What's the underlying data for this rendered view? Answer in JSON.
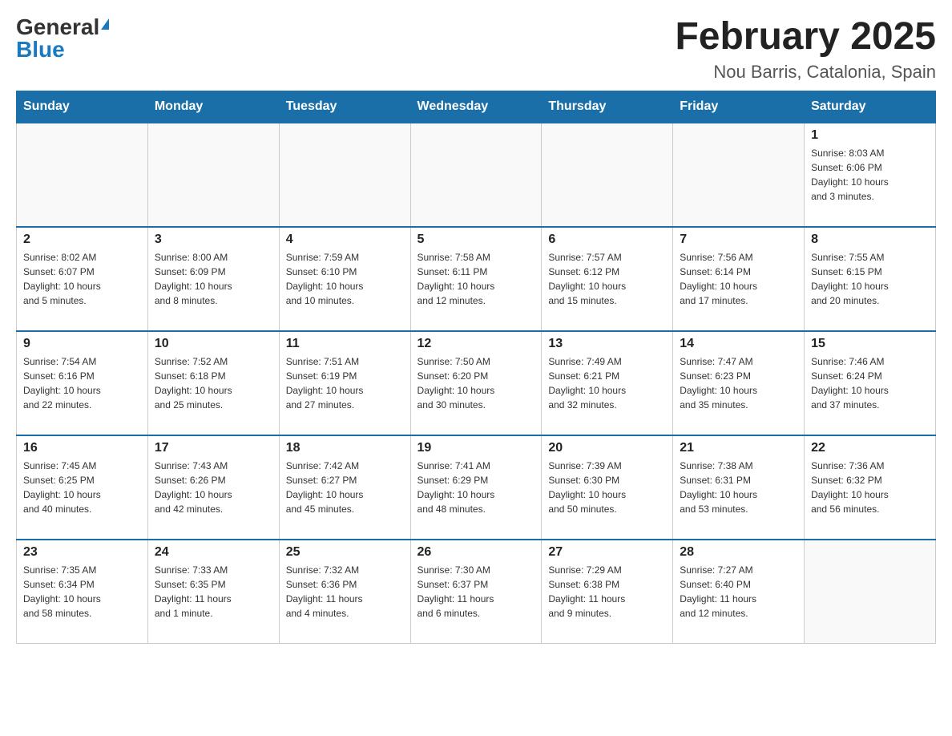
{
  "logo": {
    "general": "General",
    "blue": "Blue"
  },
  "title": "February 2025",
  "location": "Nou Barris, Catalonia, Spain",
  "weekdays": [
    "Sunday",
    "Monday",
    "Tuesday",
    "Wednesday",
    "Thursday",
    "Friday",
    "Saturday"
  ],
  "weeks": [
    [
      {
        "day": "",
        "info": ""
      },
      {
        "day": "",
        "info": ""
      },
      {
        "day": "",
        "info": ""
      },
      {
        "day": "",
        "info": ""
      },
      {
        "day": "",
        "info": ""
      },
      {
        "day": "",
        "info": ""
      },
      {
        "day": "1",
        "info": "Sunrise: 8:03 AM\nSunset: 6:06 PM\nDaylight: 10 hours\nand 3 minutes."
      }
    ],
    [
      {
        "day": "2",
        "info": "Sunrise: 8:02 AM\nSunset: 6:07 PM\nDaylight: 10 hours\nand 5 minutes."
      },
      {
        "day": "3",
        "info": "Sunrise: 8:00 AM\nSunset: 6:09 PM\nDaylight: 10 hours\nand 8 minutes."
      },
      {
        "day": "4",
        "info": "Sunrise: 7:59 AM\nSunset: 6:10 PM\nDaylight: 10 hours\nand 10 minutes."
      },
      {
        "day": "5",
        "info": "Sunrise: 7:58 AM\nSunset: 6:11 PM\nDaylight: 10 hours\nand 12 minutes."
      },
      {
        "day": "6",
        "info": "Sunrise: 7:57 AM\nSunset: 6:12 PM\nDaylight: 10 hours\nand 15 minutes."
      },
      {
        "day": "7",
        "info": "Sunrise: 7:56 AM\nSunset: 6:14 PM\nDaylight: 10 hours\nand 17 minutes."
      },
      {
        "day": "8",
        "info": "Sunrise: 7:55 AM\nSunset: 6:15 PM\nDaylight: 10 hours\nand 20 minutes."
      }
    ],
    [
      {
        "day": "9",
        "info": "Sunrise: 7:54 AM\nSunset: 6:16 PM\nDaylight: 10 hours\nand 22 minutes."
      },
      {
        "day": "10",
        "info": "Sunrise: 7:52 AM\nSunset: 6:18 PM\nDaylight: 10 hours\nand 25 minutes."
      },
      {
        "day": "11",
        "info": "Sunrise: 7:51 AM\nSunset: 6:19 PM\nDaylight: 10 hours\nand 27 minutes."
      },
      {
        "day": "12",
        "info": "Sunrise: 7:50 AM\nSunset: 6:20 PM\nDaylight: 10 hours\nand 30 minutes."
      },
      {
        "day": "13",
        "info": "Sunrise: 7:49 AM\nSunset: 6:21 PM\nDaylight: 10 hours\nand 32 minutes."
      },
      {
        "day": "14",
        "info": "Sunrise: 7:47 AM\nSunset: 6:23 PM\nDaylight: 10 hours\nand 35 minutes."
      },
      {
        "day": "15",
        "info": "Sunrise: 7:46 AM\nSunset: 6:24 PM\nDaylight: 10 hours\nand 37 minutes."
      }
    ],
    [
      {
        "day": "16",
        "info": "Sunrise: 7:45 AM\nSunset: 6:25 PM\nDaylight: 10 hours\nand 40 minutes."
      },
      {
        "day": "17",
        "info": "Sunrise: 7:43 AM\nSunset: 6:26 PM\nDaylight: 10 hours\nand 42 minutes."
      },
      {
        "day": "18",
        "info": "Sunrise: 7:42 AM\nSunset: 6:27 PM\nDaylight: 10 hours\nand 45 minutes."
      },
      {
        "day": "19",
        "info": "Sunrise: 7:41 AM\nSunset: 6:29 PM\nDaylight: 10 hours\nand 48 minutes."
      },
      {
        "day": "20",
        "info": "Sunrise: 7:39 AM\nSunset: 6:30 PM\nDaylight: 10 hours\nand 50 minutes."
      },
      {
        "day": "21",
        "info": "Sunrise: 7:38 AM\nSunset: 6:31 PM\nDaylight: 10 hours\nand 53 minutes."
      },
      {
        "day": "22",
        "info": "Sunrise: 7:36 AM\nSunset: 6:32 PM\nDaylight: 10 hours\nand 56 minutes."
      }
    ],
    [
      {
        "day": "23",
        "info": "Sunrise: 7:35 AM\nSunset: 6:34 PM\nDaylight: 10 hours\nand 58 minutes."
      },
      {
        "day": "24",
        "info": "Sunrise: 7:33 AM\nSunset: 6:35 PM\nDaylight: 11 hours\nand 1 minute."
      },
      {
        "day": "25",
        "info": "Sunrise: 7:32 AM\nSunset: 6:36 PM\nDaylight: 11 hours\nand 4 minutes."
      },
      {
        "day": "26",
        "info": "Sunrise: 7:30 AM\nSunset: 6:37 PM\nDaylight: 11 hours\nand 6 minutes."
      },
      {
        "day": "27",
        "info": "Sunrise: 7:29 AM\nSunset: 6:38 PM\nDaylight: 11 hours\nand 9 minutes."
      },
      {
        "day": "28",
        "info": "Sunrise: 7:27 AM\nSunset: 6:40 PM\nDaylight: 11 hours\nand 12 minutes."
      },
      {
        "day": "",
        "info": ""
      }
    ]
  ]
}
